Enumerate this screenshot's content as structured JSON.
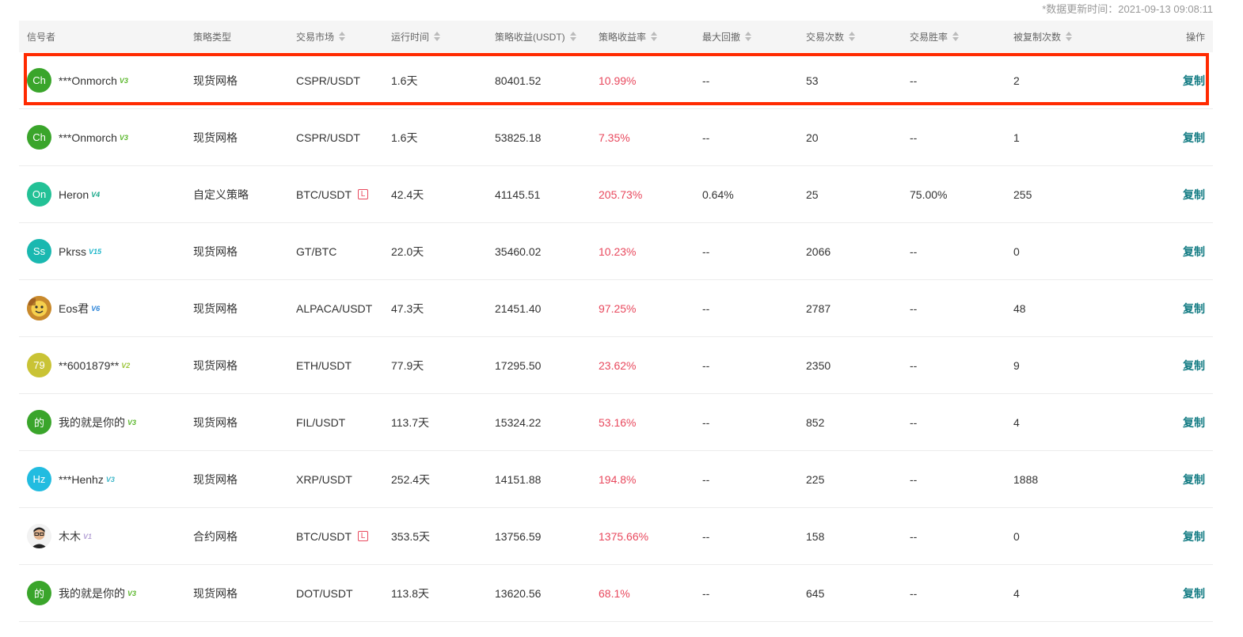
{
  "update_time": "*数据更新时间：2021-09-13 09:08:11",
  "columns": [
    "信号者",
    "策略类型",
    "交易市场",
    "运行时间",
    "策略收益(USDT)",
    "策略收益率",
    "最大回撤",
    "交易次数",
    "交易胜率",
    "被复制次数",
    "操作"
  ],
  "colors": {
    "rate": "#e8485d",
    "copy": "#127b83",
    "highlight": "#ff2a00"
  },
  "rows": [
    {
      "avatar": "Ch",
      "avatar_color": "#3aa52b",
      "name": "***Onmorch",
      "level": "V3",
      "level_color": "#5cb82e",
      "type": "现货网格",
      "market": "CSPR/USDT",
      "leverage": "",
      "runtime": "1.6天",
      "profit": "80401.52",
      "rate": "10.99%",
      "drawdown": "--",
      "trades": "53",
      "winrate": "--",
      "copied": "2",
      "action": "复制"
    },
    {
      "avatar": "Ch",
      "avatar_color": "#3aa52b",
      "name": "***Onmorch",
      "level": "V3",
      "level_color": "#5cb82e",
      "type": "现货网格",
      "market": "CSPR/USDT",
      "leverage": "",
      "runtime": "1.6天",
      "profit": "53825.18",
      "rate": "7.35%",
      "drawdown": "--",
      "trades": "20",
      "winrate": "--",
      "copied": "1",
      "action": "复制"
    },
    {
      "avatar": "On",
      "avatar_color": "#23c196",
      "name": "Heron",
      "level": "V4",
      "level_color": "#1aa88a",
      "type": "自定义策略",
      "market": "BTC/USDT",
      "leverage": "L",
      "runtime": "42.4天",
      "profit": "41145.51",
      "rate": "205.73%",
      "drawdown": "0.64%",
      "trades": "25",
      "winrate": "75.00%",
      "copied": "255",
      "action": "复制"
    },
    {
      "avatar": "Ss",
      "avatar_color": "#1ab8b0",
      "name": "Pkrss",
      "level": "V15",
      "level_color": "#1bb5c9",
      "type": "现货网格",
      "market": "GT/BTC",
      "leverage": "",
      "runtime": "22.0天",
      "profit": "35460.02",
      "rate": "10.23%",
      "drawdown": "--",
      "trades": "2066",
      "winrate": "--",
      "copied": "0",
      "action": "复制"
    },
    {
      "avatar": "",
      "avatar_color": "#c98a2c",
      "name": "Eos君",
      "level": "V6",
      "level_color": "#2f86d9",
      "type": "现货网格",
      "market": "ALPACA/USDT",
      "leverage": "",
      "runtime": "47.3天",
      "profit": "21451.40",
      "rate": "97.25%",
      "drawdown": "--",
      "trades": "2787",
      "winrate": "--",
      "copied": "48",
      "action": "复制"
    },
    {
      "avatar": "79",
      "avatar_color": "#c9c335",
      "name": "**6001879**",
      "level": "V2",
      "level_color": "#9cc53a",
      "type": "现货网格",
      "market": "ETH/USDT",
      "leverage": "",
      "runtime": "77.9天",
      "profit": "17295.50",
      "rate": "23.62%",
      "drawdown": "--",
      "trades": "2350",
      "winrate": "--",
      "copied": "9",
      "action": "复制"
    },
    {
      "avatar": "的",
      "avatar_color": "#3aa52b",
      "name": "我的就是你的",
      "level": "V3",
      "level_color": "#5cb82e",
      "type": "现货网格",
      "market": "FIL/USDT",
      "leverage": "",
      "runtime": "113.7天",
      "profit": "15324.22",
      "rate": "53.16%",
      "drawdown": "--",
      "trades": "852",
      "winrate": "--",
      "copied": "4",
      "action": "复制"
    },
    {
      "avatar": "Hz",
      "avatar_color": "#22bce0",
      "name": "***Henhz",
      "level": "V3",
      "level_color": "#3fb7c9",
      "type": "现货网格",
      "market": "XRP/USDT",
      "leverage": "",
      "runtime": "252.4天",
      "profit": "14151.88",
      "rate": "194.8%",
      "drawdown": "--",
      "trades": "225",
      "winrate": "--",
      "copied": "1888",
      "action": "复制"
    },
    {
      "avatar": "",
      "avatar_color": "#f2f2f2",
      "name": "木木",
      "level": "V1",
      "level_color": "#b6a3d6",
      "type": "合约网格",
      "market": "BTC/USDT",
      "leverage": "L",
      "runtime": "353.5天",
      "profit": "13756.59",
      "rate": "1375.66%",
      "drawdown": "--",
      "trades": "158",
      "winrate": "--",
      "copied": "0",
      "action": "复制"
    },
    {
      "avatar": "的",
      "avatar_color": "#3aa52b",
      "name": "我的就是你的",
      "level": "V3",
      "level_color": "#5cb82e",
      "type": "现货网格",
      "market": "DOT/USDT",
      "leverage": "",
      "runtime": "113.8天",
      "profit": "13620.56",
      "rate": "68.1%",
      "drawdown": "--",
      "trades": "645",
      "winrate": "--",
      "copied": "4",
      "action": "复制"
    }
  ]
}
